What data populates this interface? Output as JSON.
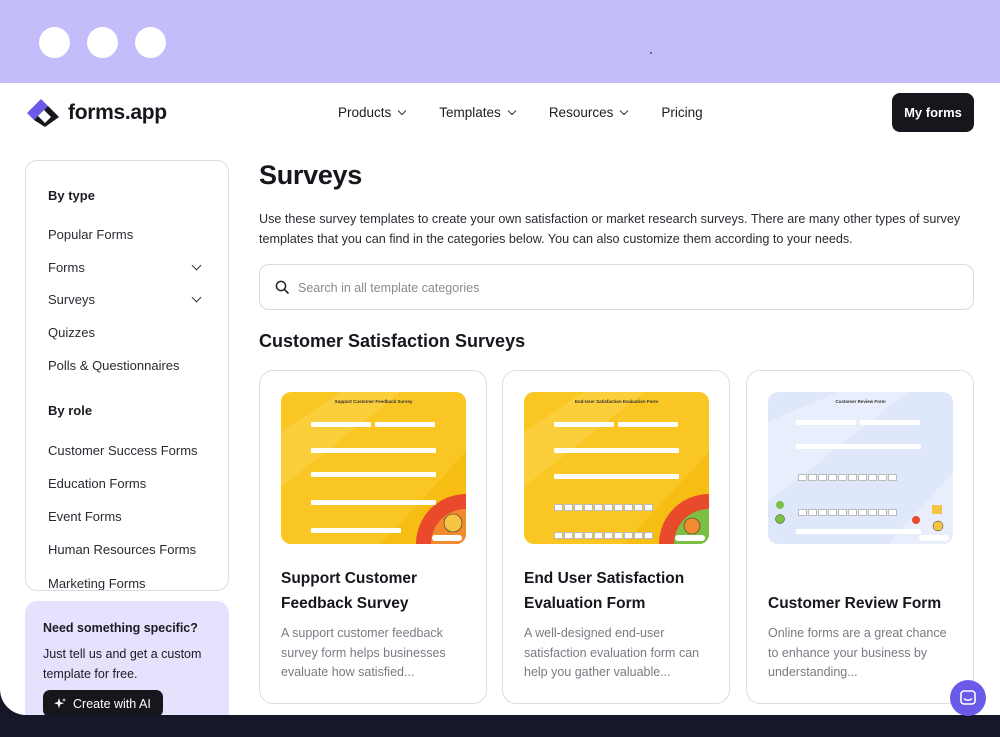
{
  "brand": {
    "name": "forms.app",
    "accent": "#6b5ae8",
    "frame_color": "#c4bdfb"
  },
  "nav": {
    "items": [
      {
        "label": "Products",
        "has_dropdown": true
      },
      {
        "label": "Templates",
        "has_dropdown": true
      },
      {
        "label": "Resources",
        "has_dropdown": true
      },
      {
        "label": "Pricing",
        "has_dropdown": false
      }
    ],
    "my_forms_label": "My forms"
  },
  "sidebar": {
    "by_type_heading": "By type",
    "type_items": [
      {
        "label": "Popular Forms",
        "expandable": false
      },
      {
        "label": "Forms",
        "expandable": true
      },
      {
        "label": "Surveys",
        "expandable": true
      },
      {
        "label": "Quizzes",
        "expandable": false
      },
      {
        "label": "Polls & Questionnaires",
        "expandable": false
      }
    ],
    "by_role_heading": "By role",
    "role_items": [
      {
        "label": "Customer Success Forms"
      },
      {
        "label": "Education Forms"
      },
      {
        "label": "Event Forms"
      },
      {
        "label": "Human Resources Forms"
      },
      {
        "label": "Marketing Forms"
      }
    ]
  },
  "promo": {
    "title": "Need something specific?",
    "text": "Just tell us and get a custom template for free.",
    "button_label": "Create with AI"
  },
  "main": {
    "title": "Surveys",
    "intro": "Use these survey templates to create your own satisfaction or market research surveys. There are many other types of survey templates that you can find in the categories below. You can also customize them according to your needs.",
    "search_placeholder": "Search in all template categories",
    "section_title": "Customer Satisfaction Surveys",
    "cards": [
      {
        "title": "Support Customer Feedback Survey",
        "description": "A support customer feedback survey form helps businesses evaluate how satisfied...",
        "thumb_heading": "Support Customer Feedback Survey",
        "thumb_theme": "yellow"
      },
      {
        "title": "End User Satisfaction Evaluation Form",
        "description": "A well-designed end-user satisfaction evaluation form can help you gather valuable...",
        "thumb_heading": "End-User Satisfaction Evaluation Form",
        "thumb_theme": "yellow"
      },
      {
        "title": "Customer Review Form",
        "description": "Online forms are a great chance to enhance your business by understanding...",
        "thumb_heading": "Customer Review Form",
        "thumb_theme": "light-blue"
      }
    ]
  }
}
